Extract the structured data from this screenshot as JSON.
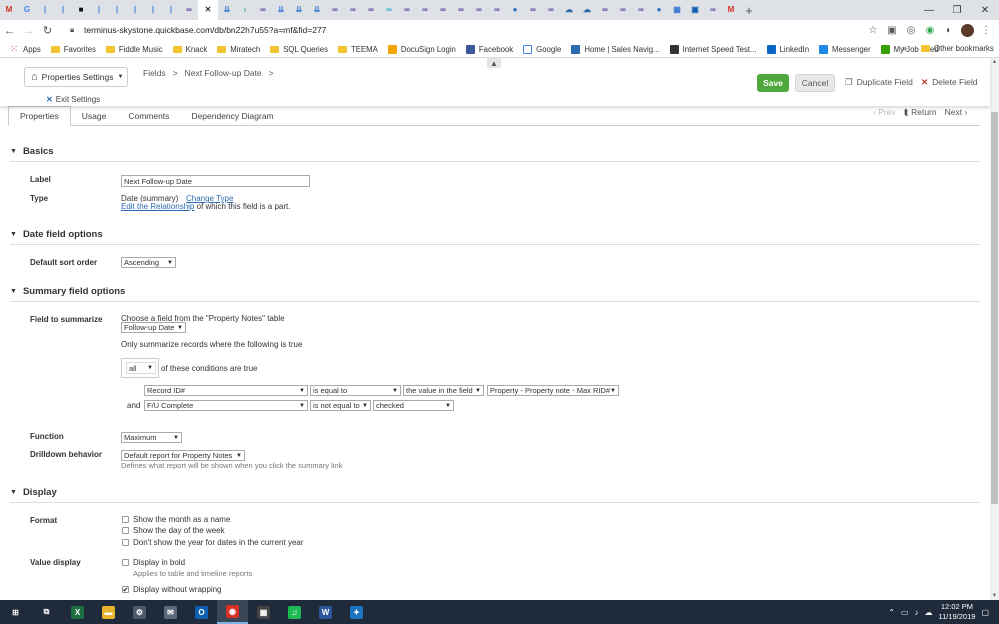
{
  "browser": {
    "tabs": [
      {
        "icon": "gmail-icon",
        "glyph": "M",
        "color": "#d93025"
      },
      {
        "icon": "google-icon",
        "glyph": "G",
        "color": "#4285f4"
      },
      {
        "icon": "quickbase-icon",
        "glyph": "|",
        "color": "#3a7bd5"
      },
      {
        "icon": "quickbase-icon",
        "glyph": "|",
        "color": "#3a7bd5"
      },
      {
        "icon": "black-tab-icon",
        "glyph": "■",
        "color": "#111111"
      },
      {
        "icon": "quickbase-icon",
        "glyph": "|",
        "color": "#3a7bd5"
      },
      {
        "icon": "quickbase-icon",
        "glyph": "|",
        "color": "#3a7bd5"
      },
      {
        "icon": "quickbase-icon",
        "glyph": "|",
        "color": "#3a7bd5"
      },
      {
        "icon": "quickbase-icon",
        "glyph": "|",
        "color": "#3a7bd5"
      },
      {
        "icon": "quickbase-icon",
        "glyph": "|",
        "color": "#3a7bd5"
      },
      {
        "icon": "purple-loop-icon",
        "glyph": "∞",
        "color": "#5b3fa0"
      },
      {
        "icon": "close-tab-icon",
        "glyph": "✕",
        "color": "#333333",
        "active": true
      },
      {
        "icon": "blue-arrow-icon",
        "glyph": "⇊",
        "color": "#3a7bd5"
      },
      {
        "icon": "green-arrow-icon",
        "glyph": "›",
        "color": "#34a853"
      },
      {
        "icon": "purple-loop-icon",
        "glyph": "∞",
        "color": "#5b3fa0"
      },
      {
        "icon": "blue-arrow-icon",
        "glyph": "⇊",
        "color": "#3a7bd5"
      },
      {
        "icon": "blue-arrow-icon",
        "glyph": "⇊",
        "color": "#3a7bd5"
      },
      {
        "icon": "blue-arrow-icon",
        "glyph": "⇊",
        "color": "#3a7bd5"
      },
      {
        "icon": "purple-loop-icon",
        "glyph": "∞",
        "color": "#5b3fa0"
      },
      {
        "icon": "purple-loop-icon",
        "glyph": "∞",
        "color": "#5b3fa0"
      },
      {
        "icon": "purple-loop-icon",
        "glyph": "∞",
        "color": "#5b3fa0"
      },
      {
        "icon": "teal-loop-icon",
        "glyph": "∞",
        "color": "#28b5c8"
      },
      {
        "icon": "purple-loop-icon",
        "glyph": "∞",
        "color": "#5b3fa0"
      },
      {
        "icon": "purple-loop-icon",
        "glyph": "∞",
        "color": "#5b3fa0"
      },
      {
        "icon": "purple-loop-icon",
        "glyph": "∞",
        "color": "#5b3fa0"
      },
      {
        "icon": "purple-loop-icon",
        "glyph": "∞",
        "color": "#5b3fa0"
      },
      {
        "icon": "purple-loop-icon",
        "glyph": "∞",
        "color": "#5b3fa0"
      },
      {
        "icon": "purple-loop-icon",
        "glyph": "∞",
        "color": "#5b3fa0"
      },
      {
        "icon": "blue-circle-icon",
        "glyph": "●",
        "color": "#1e73be"
      },
      {
        "icon": "purple-loop-icon",
        "glyph": "∞",
        "color": "#5b3fa0"
      },
      {
        "icon": "purple-loop-icon",
        "glyph": "∞",
        "color": "#5b3fa0"
      },
      {
        "icon": "blue-cloud-icon",
        "glyph": "☁",
        "color": "#2b6cb0"
      },
      {
        "icon": "blue-cloud-icon",
        "glyph": "☁",
        "color": "#2b6cb0"
      },
      {
        "icon": "purple-loop-icon",
        "glyph": "∞",
        "color": "#5b3fa0"
      },
      {
        "icon": "purple-loop-icon",
        "glyph": "∞",
        "color": "#5b3fa0"
      },
      {
        "icon": "purple-loop-icon",
        "glyph": "∞",
        "color": "#5b3fa0"
      },
      {
        "icon": "blue-circle-icon",
        "glyph": "●",
        "color": "#1e73be"
      },
      {
        "icon": "grid-icon",
        "glyph": "▦",
        "color": "#3a7bd5"
      },
      {
        "icon": "outlook-icon",
        "glyph": "▣",
        "color": "#0f5fb0"
      },
      {
        "icon": "purple-loop-icon",
        "glyph": "∞",
        "color": "#5b3fa0"
      },
      {
        "icon": "gmail-icon",
        "glyph": "M",
        "color": "#d93025"
      }
    ],
    "url": "terminus-skystone.quickbase.com/db/bn22h7u55?a=mf&fid=277"
  },
  "bookmarks": [
    {
      "label": "Apps",
      "icon": "apps-grid-icon",
      "kind": "apps"
    },
    {
      "label": "Favorites",
      "icon": "folder-icon",
      "kind": "folder"
    },
    {
      "label": "Fiddle Music",
      "icon": "folder-icon",
      "kind": "folder"
    },
    {
      "label": "Knack",
      "icon": "folder-icon",
      "kind": "folder"
    },
    {
      "label": "Miratech",
      "icon": "folder-icon",
      "kind": "folder"
    },
    {
      "label": "SQL Queries",
      "icon": "folder-icon",
      "kind": "folder"
    },
    {
      "label": "TEEMA",
      "icon": "folder-icon",
      "kind": "folder"
    },
    {
      "label": "DocuSign Login",
      "icon": "docusign-icon",
      "kind": "site",
      "color": "#f0a500"
    },
    {
      "label": "Facebook",
      "icon": "facebook-icon",
      "kind": "site",
      "color": "#3b5998"
    },
    {
      "label": "Google",
      "icon": "google-icon",
      "kind": "site",
      "color": "#ffffff"
    },
    {
      "label": "Home | Sales Navig...",
      "icon": "compass-icon",
      "kind": "site",
      "color": "#2b6cb0"
    },
    {
      "label": "Internet Speed Test...",
      "icon": "speed-icon",
      "kind": "site",
      "color": "#333333"
    },
    {
      "label": "LinkedIn",
      "icon": "linkedin-icon",
      "kind": "site",
      "color": "#0a66c2"
    },
    {
      "label": "Messenger",
      "icon": "messenger-icon",
      "kind": "site",
      "color": "#1e88e5"
    },
    {
      "label": "My Job Feed",
      "icon": "upwork-icon",
      "kind": "site",
      "color": "#37a000"
    }
  ],
  "bookmarks_more": "»",
  "bookmarks_other": "Other bookmarks",
  "app": {
    "properties_selector": "Properties Settings",
    "breadcrumbs": [
      "Fields",
      ">",
      "Next Follow-up Date",
      ">"
    ],
    "exit_settings": "Exit Settings",
    "save_label": "Save",
    "cancel_label": "Cancel",
    "duplicate_label": "Duplicate Field",
    "delete_label": "Delete Field",
    "subtabs": [
      "Properties",
      "Usage",
      "Comments",
      "Dependency Diagram"
    ],
    "pager": {
      "prev": "‹ Prev",
      "return": "Return",
      "next": "Next"
    }
  },
  "basics": {
    "title": "Basics",
    "label_caption": "Label",
    "label_value": "Next Follow-up Date",
    "type_caption": "Type",
    "type_value": "Date (summary)",
    "change_type": "Change Type",
    "edit_rel_link": "Edit the Relationship",
    "edit_rel_suffix": "of which this field is a part."
  },
  "date_options": {
    "title": "Date field options",
    "sort_caption": "Default sort order",
    "sort_value": "Ascending"
  },
  "summary": {
    "title": "Summary field options",
    "field_caption": "Field to summarize",
    "choose_text": "Choose a field from the \"Property Notes\" table",
    "field_value": "Follow-up Date",
    "only_text": "Only summarize records where the following is true",
    "all_value": "all",
    "conditions_text": "of these conditions are true",
    "cond1": {
      "field": "Record ID#",
      "op": "is equal to",
      "mode": "the value in the field",
      "target": "Property - Property note - Max RID#"
    },
    "and_label": "and",
    "cond2": {
      "field": "F/U Complete",
      "op": "is not equal to",
      "value": "checked"
    },
    "function_caption": "Function",
    "function_value": "Maximum",
    "drill_caption": "Drilldown behavior",
    "drill_value": "Default report for Property Notes",
    "drill_hint": "Defines what report will be shown when you click the summary link"
  },
  "display": {
    "title": "Display",
    "format_caption": "Format",
    "opt1": "Show the month as a name",
    "opt2": "Show the day of the week",
    "opt3": "Don't show the year for dates in the current year",
    "value_caption": "Value display",
    "bold": "Display in bold",
    "bold_hint": "Applies to table and timeline reports",
    "nowrap": "Display without wrapping",
    "nowrap_checked": true
  },
  "taskbar": {
    "apps": [
      {
        "icon": "windows-start-icon",
        "glyph": "⊞",
        "color": "#1f2b3a"
      },
      {
        "icon": "task-view-icon",
        "glyph": "⧉",
        "color": "#1f2b3a"
      },
      {
        "icon": "excel-icon",
        "glyph": "X",
        "color": "#1d6f42"
      },
      {
        "icon": "file-explorer-icon",
        "glyph": "▬",
        "color": "#e8b32a"
      },
      {
        "icon": "settings-app-icon",
        "glyph": "⚙",
        "color": "#4a5a6a"
      },
      {
        "icon": "mail-icon",
        "glyph": "✉",
        "color": "#5a6a7a"
      },
      {
        "icon": "outlook-icon",
        "glyph": "O",
        "color": "#0f5fb0"
      },
      {
        "icon": "chrome-icon",
        "glyph": "◉",
        "color": "#d93025",
        "active": true
      },
      {
        "icon": "calculator-icon",
        "glyph": "▦",
        "color": "#444444"
      },
      {
        "icon": "spotify-icon",
        "glyph": "♫",
        "color": "#1db954"
      },
      {
        "icon": "word-icon",
        "glyph": "W",
        "color": "#2b579a"
      },
      {
        "icon": "app-icon",
        "glyph": "✦",
        "color": "#1e73be"
      }
    ],
    "time": "12:02 PM",
    "date": "11/19/2019"
  }
}
